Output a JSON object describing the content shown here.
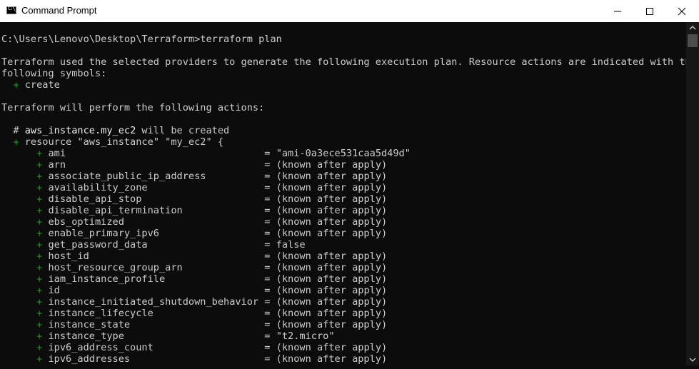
{
  "window": {
    "title": "Command Prompt",
    "app_icon_text": "C:\\_",
    "colors": {
      "background": "#0c0c0c",
      "text": "#cccccc",
      "plus": "#13a10e",
      "bright": "#f2f2f2",
      "titlebar": "#ffffff"
    }
  },
  "controls": [
    "minimize-icon",
    "maximize-icon",
    "close-icon"
  ],
  "terminal": {
    "prompt": "C:\\Users\\Lenovo\\Desktop\\Terraform>terraform plan",
    "intro_1": "Terraform used the selected providers to generate the following execution plan. Resource actions are indicated with the",
    "intro_2": "following symbols:",
    "create_sym": "+",
    "create_word": " create",
    "perform": "Terraform will perform the following actions:",
    "comment_hash": "  # ",
    "comment_resource": "aws_instance.my_ec2",
    "comment_tail": " will be created",
    "resource_line": " resource \"aws_instance\" \"my_ec2\" {",
    "attributes": [
      {
        "name": "ami",
        "value": "\"ami-0a3ece531caa5d49d\""
      },
      {
        "name": "arn",
        "value": "(known after apply)"
      },
      {
        "name": "associate_public_ip_address",
        "value": "(known after apply)"
      },
      {
        "name": "availability_zone",
        "value": "(known after apply)"
      },
      {
        "name": "disable_api_stop",
        "value": "(known after apply)"
      },
      {
        "name": "disable_api_termination",
        "value": "(known after apply)"
      },
      {
        "name": "ebs_optimized",
        "value": "(known after apply)"
      },
      {
        "name": "enable_primary_ipv6",
        "value": "(known after apply)"
      },
      {
        "name": "get_password_data",
        "value": "false"
      },
      {
        "name": "host_id",
        "value": "(known after apply)"
      },
      {
        "name": "host_resource_group_arn",
        "value": "(known after apply)"
      },
      {
        "name": "iam_instance_profile",
        "value": "(known after apply)"
      },
      {
        "name": "id",
        "value": "(known after apply)"
      },
      {
        "name": "instance_initiated_shutdown_behavior",
        "value": "(known after apply)"
      },
      {
        "name": "instance_lifecycle",
        "value": "(known after apply)"
      },
      {
        "name": "instance_state",
        "value": "(known after apply)"
      },
      {
        "name": "instance_type",
        "value": "\"t2.micro\""
      },
      {
        "name": "ipv6_address_count",
        "value": "(known after apply)"
      },
      {
        "name": "ipv6_addresses",
        "value": "(known after apply)"
      }
    ]
  }
}
